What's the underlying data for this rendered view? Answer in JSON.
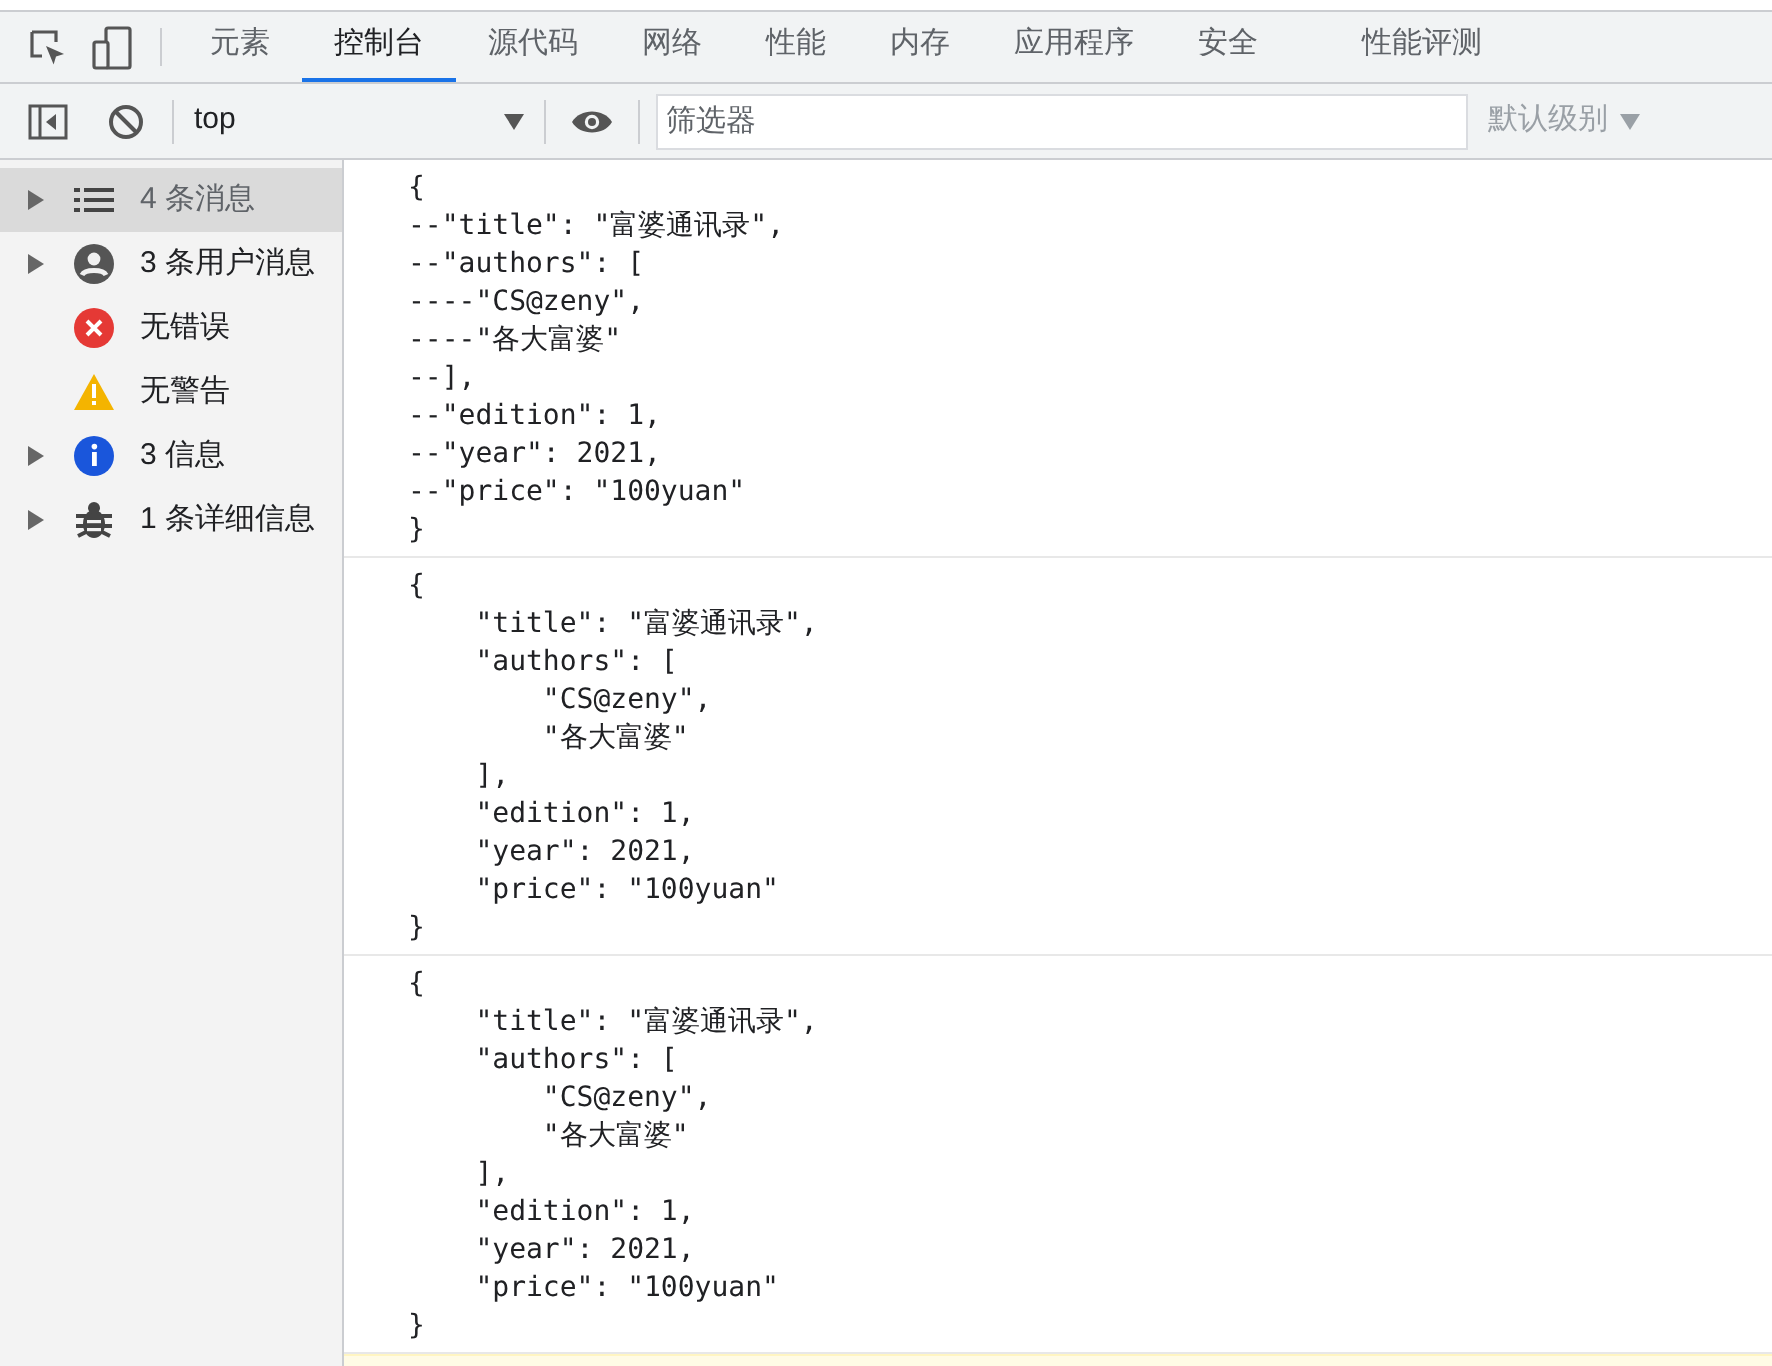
{
  "tabs": [
    {
      "label": "元素",
      "selected": false
    },
    {
      "label": "控制台",
      "selected": true
    },
    {
      "label": "源代码",
      "selected": false
    },
    {
      "label": "网络",
      "selected": false
    },
    {
      "label": "性能",
      "selected": false
    },
    {
      "label": "内存",
      "selected": false
    },
    {
      "label": "应用程序",
      "selected": false
    },
    {
      "label": "安全",
      "selected": false
    },
    {
      "label": "性能评测",
      "selected": false
    }
  ],
  "toolbar": {
    "context": "top",
    "filter": {
      "placeholder": "筛选器"
    },
    "levels": "默认级别"
  },
  "sidebar": {
    "items": [
      {
        "kind": "list",
        "label": "4 条消息",
        "expandable": true,
        "selected": true
      },
      {
        "kind": "user",
        "label": "3 条用户消息",
        "expandable": true,
        "selected": false
      },
      {
        "kind": "error",
        "label": "无错误",
        "expandable": false,
        "selected": false
      },
      {
        "kind": "warning",
        "label": "无警告",
        "expandable": false,
        "selected": false
      },
      {
        "kind": "info",
        "label": "3 信息",
        "expandable": true,
        "selected": false
      },
      {
        "kind": "verbose",
        "label": "1 条详细信息",
        "expandable": true,
        "selected": false
      }
    ]
  },
  "messages": [
    {
      "kind": "log",
      "lines": [
        "{",
        "--\"title\": \"富婆通讯录\",",
        "--\"authors\": [",
        "----\"CS@zeny\",",
        "----\"各大富婆\"",
        "--],",
        "--\"edition\": 1,",
        "--\"year\": 2021,",
        "--\"price\": \"100yuan\"",
        "}"
      ]
    },
    {
      "kind": "log",
      "lines": [
        "{",
        "    \"title\": \"富婆通讯录\",",
        "    \"authors\": [",
        "        \"CS@zeny\",",
        "        \"各大富婆\"",
        "    ],",
        "    \"edition\": 1,",
        "    \"year\": 2021,",
        "    \"price\": \"100yuan\"",
        "}"
      ]
    },
    {
      "kind": "log",
      "lines": [
        "{",
        "    \"title\": \"富婆通讯录\",",
        "    \"authors\": [",
        "        \"CS@zeny\",",
        "        \"各大富婆\"",
        "    ],",
        "    \"edition\": 1,",
        "    \"year\": 2021,",
        "    \"price\": \"100yuan\"",
        "}"
      ]
    },
    {
      "kind": "warning"
    }
  ]
}
